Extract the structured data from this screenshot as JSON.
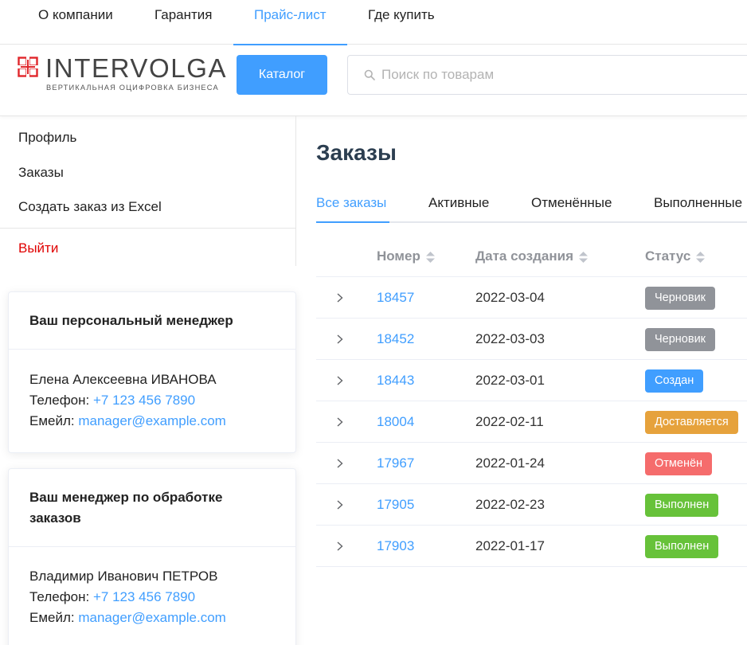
{
  "topnav": {
    "items": [
      {
        "label": "О компании",
        "active": false
      },
      {
        "label": "Гарантия",
        "active": false
      },
      {
        "label": "Прайс-лист",
        "active": true
      },
      {
        "label": "Где купить",
        "active": false
      }
    ]
  },
  "header": {
    "logo": {
      "name": "INTERVOLGA",
      "tagline": "ВЕРТИКАЛЬНАЯ ОЦИФРОВКА БИЗНЕСА",
      "icon": "intervolga-logo-icon"
    },
    "catalog_label": "Каталог",
    "search": {
      "placeholder": "Поиск по товарам",
      "value": "",
      "icon": "search-icon"
    }
  },
  "sidebar": {
    "items": [
      {
        "label": "Профиль"
      },
      {
        "label": "Заказы"
      },
      {
        "label": "Создать заказ из Excel"
      }
    ],
    "logout_label": "Выйти"
  },
  "managers": [
    {
      "title": "Ваш персональный менеджер",
      "name": "Елена Алексеевна ИВАНОВА",
      "phone_label": "Телефон:",
      "phone": "+7 123 456 7890",
      "email_label": "Емейл:",
      "email": "manager@example.com"
    },
    {
      "title_line1": "Ваш менеджер по обработке",
      "title_line2": "заказов",
      "name": "Владимир Иванович ПЕТРОВ",
      "phone_label": "Телефон:",
      "phone": "+7 123 456 7890",
      "email_label": "Емейл:",
      "email": "manager@example.com"
    }
  ],
  "main": {
    "title": "Заказы",
    "tabs": [
      {
        "label": "Все заказы",
        "active": true
      },
      {
        "label": "Активные",
        "active": false
      },
      {
        "label": "Отменённые",
        "active": false
      },
      {
        "label": "Выполненные",
        "active": false
      }
    ],
    "columns": [
      "Номер",
      "Дата создания",
      "Статус"
    ],
    "orders": [
      {
        "number": "18457",
        "date": "2022-03-04",
        "status": "Черновик"
      },
      {
        "number": "18452",
        "date": "2022-03-03",
        "status": "Черновик"
      },
      {
        "number": "18443",
        "date": "2022-03-01",
        "status": "Создан"
      },
      {
        "number": "18004",
        "date": "2022-02-11",
        "status": "Доставляется"
      },
      {
        "number": "17967",
        "date": "2022-01-24",
        "status": "Отменён"
      },
      {
        "number": "17905",
        "date": "2022-02-23",
        "status": "Выполнен"
      },
      {
        "number": "17903",
        "date": "2022-01-17",
        "status": "Выполнен"
      }
    ]
  },
  "colors": {
    "accent": "#409eff",
    "status_draft": "#909399",
    "status_created": "#409eff",
    "status_delivering": "#e6a23c",
    "status_cancelled": "#f56c6c",
    "status_done": "#67c23a",
    "logout": "#e00000"
  }
}
